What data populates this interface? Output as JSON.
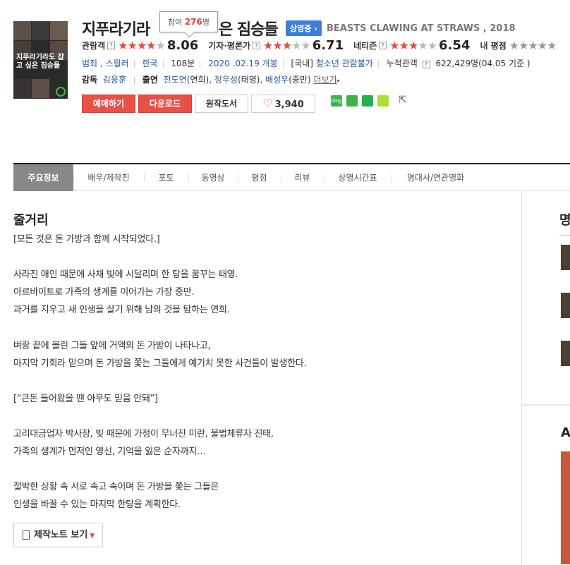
{
  "movie": {
    "title": "지푸라기라도 잡고 싶은 짐승들",
    "title_visible_left": "지푸라기라",
    "title_visible_right": "은 짐승들",
    "status_badge": "상영중 ›",
    "english_title": "BEASTS CLAWING AT STRAWS , 2018",
    "poster_title": "지푸라기라도 잡고 싶은 짐승들"
  },
  "tooltip": {
    "prefix": "참여",
    "count": "276",
    "suffix": "명"
  },
  "ratings": {
    "audience": {
      "label": "관람객",
      "stars_on": 4,
      "score": "8.06"
    },
    "critic": {
      "label": "기자·평론가",
      "stars_on": 3.5,
      "score": "6.71"
    },
    "netizen": {
      "label": "네티즌",
      "stars_on": 3,
      "score": "6.54"
    },
    "mine": {
      "label": "내 평점"
    }
  },
  "info": {
    "genres": "범죄 , 스릴러",
    "country": "한국",
    "runtime": "108분",
    "release": "2020 .02.19 개봉",
    "grade_prefix": "[국내]",
    "grade": "청소년 관람불가",
    "cumulative_label": "누적관객",
    "cumulative_value": "622,429명(04.05 기준 )"
  },
  "credits": {
    "director_label": "감독",
    "director": "김용훈",
    "cast_label": "출연",
    "cast": [
      {
        "name": "전도연",
        "role": "(연희),"
      },
      {
        "name": "정우성",
        "role": "(태영),"
      },
      {
        "name": "배성우",
        "role": "(중만)"
      }
    ],
    "more": "더보기"
  },
  "buttons": {
    "reserve": "예매하기",
    "download": "다운로드",
    "original": "원작도서",
    "likes": "3,940"
  },
  "social": {
    "blog": "blog"
  },
  "tabs": [
    "주요정보",
    "배우/제작진",
    "포토",
    "동영상",
    "평점",
    "리뷰",
    "상영시간표",
    "명대사/연관영화"
  ],
  "synopsis": {
    "title": "줄거리",
    "text": "[모든 것은 돈 가방과 함께 시작되었다.]\n\n사라진 애인 때문에 사채 빚에 시달리며 한 탕을 꿈꾸는 태영.\n아르바이트로 가족의 생계를 이어가는 가장 중만.\n과거를 지우고 새 인생을 살기 위해 남의 것을 탐하는 연희.\n\n벼랑 끝에 몰린 그들 앞에 거액의 돈 가방이 나타나고,\n마지막 기회라 믿으며 돈 가방을 쫓는 그들에게 예기치 못한 사건들이 발생한다.\n\n[“큰돈 들어왔을 땐 아무도 믿음 안돼”]\n\n고리대금업자 박사장, 빚 때문에 가정이 무너진 미란, 불법체류자 진태,\n가족의 생계가 먼저인 영선, 기억을 잃은 순자까지…\n\n절박한 상황 속 서로 속고 속이며 돈 가방을 쫓는 그들은\n인생을 바꿀 수 있는 마지막 한탕을 계획한다.",
    "note_button": "제작노트 보기"
  },
  "sidebar": {
    "heading1": "명",
    "heading2": "A"
  },
  "colors": {
    "accent_red": "#e85048",
    "link_blue": "#2557a7",
    "badge_blue": "#3b7fd6"
  }
}
